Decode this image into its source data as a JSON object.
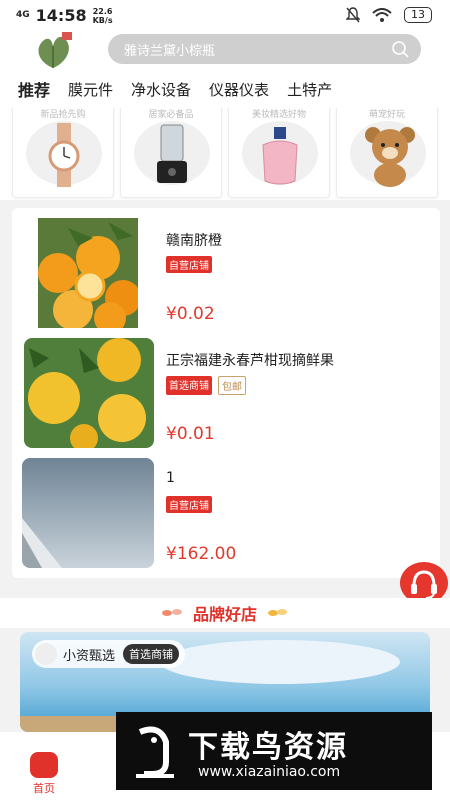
{
  "status_bar": {
    "network": "4G",
    "time": "14:58",
    "speed": "22.6",
    "speed_unit": "KB/s",
    "battery": "13"
  },
  "search": {
    "placeholder": "雅诗兰黛小棕瓶"
  },
  "tabs": [
    "推荐",
    "膜元件",
    "净水设备",
    "仪器仪表",
    "土特产"
  ],
  "category_cards": [
    "新品抢先购",
    "居家必备品",
    "美妆精选好物",
    "萌宠好玩"
  ],
  "products": [
    {
      "name": "赣南脐橙",
      "tags": [
        "自营店铺"
      ],
      "price": "¥0.02"
    },
    {
      "name": "正宗福建永春芦柑现摘鲜果",
      "tags": [
        "首选商铺",
        "包邮"
      ],
      "price": "¥0.01"
    },
    {
      "name": "1",
      "tags": [
        "自营店铺"
      ],
      "price": "¥162.00"
    }
  ],
  "brand_section": {
    "title": "品牌好店",
    "shop_name": "小资甄选",
    "shop_label": "首选商铺"
  },
  "bottom_nav": {
    "home_label": "首页"
  },
  "watermark": {
    "title": "下载鸟资源",
    "url": "www.xiazainiao.com"
  }
}
